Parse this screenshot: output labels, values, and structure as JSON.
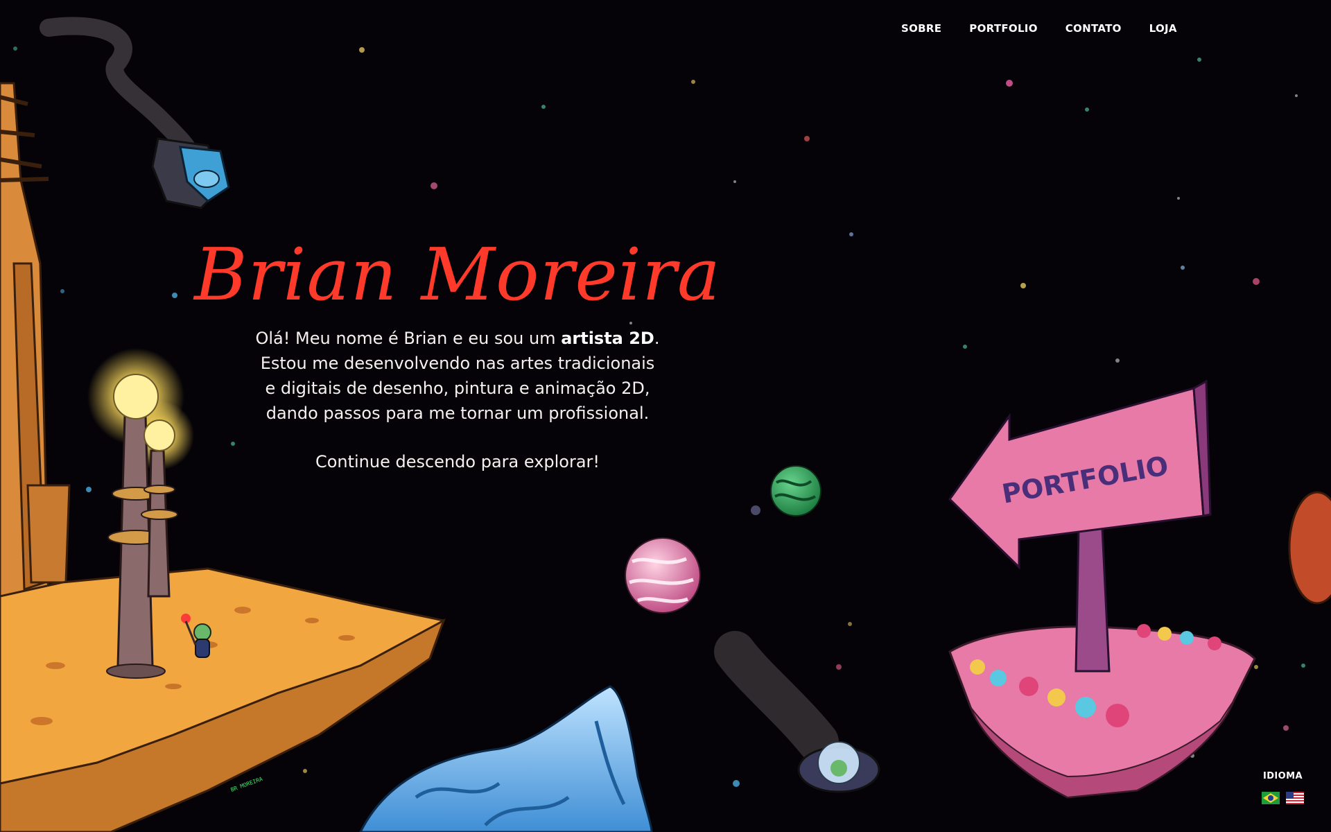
{
  "nav": {
    "items": [
      {
        "label": "SOBRE"
      },
      {
        "label": "PORTFOLIO"
      },
      {
        "label": "CONTATO"
      },
      {
        "label": "LOJA"
      }
    ]
  },
  "hero": {
    "title": "Brian Moreira",
    "intro_line1_prefix": "Olá! Meu nome é Brian e eu sou um ",
    "intro_line1_bold": "artista 2D",
    "intro_line1_suffix": ".",
    "intro_line2": "Estou me desenvolvendo nas artes tradicionais",
    "intro_line3": "e digitais de desenho, pintura e animação 2D,",
    "intro_line4": "dando passos para me tornar um profissional.",
    "explore": "Continue descendo para explorar!"
  },
  "portfolio_sign": {
    "label": "PORTFOLIO"
  },
  "language": {
    "label": "IDIOMA",
    "options": [
      "pt-BR flag",
      "en-US flag"
    ]
  },
  "signature": {
    "text": "BR MOREIRA"
  },
  "colors": {
    "background": "#050307",
    "title_red": "#ff3a2a",
    "platform_orange": "#f2a640",
    "sign_pink": "#e77aa6",
    "planet_green": "#2fa35a",
    "ice_blue": "#6fb6ec"
  }
}
